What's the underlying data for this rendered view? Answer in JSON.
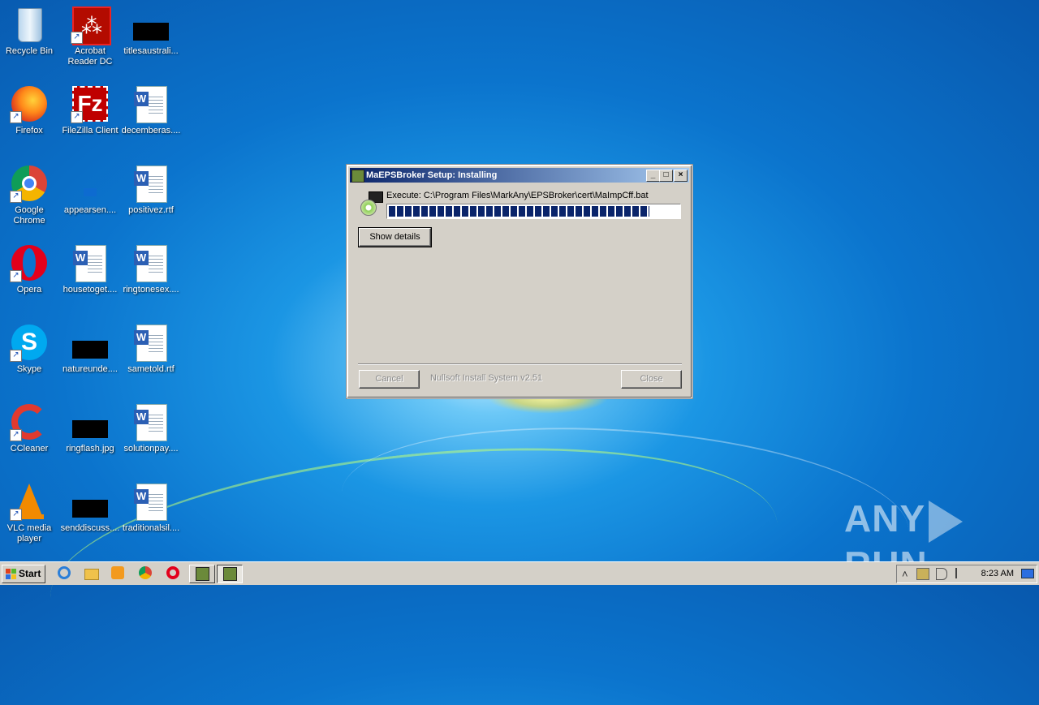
{
  "desktop": {
    "icons": [
      {
        "label": "Recycle Bin",
        "icon": "recycle-bin-icon"
      },
      {
        "label": "Acrobat Reader DC",
        "icon": "acrobat-icon"
      },
      {
        "label": "titlesaustrali...",
        "icon": "image-file-icon"
      },
      {
        "label": "Firefox",
        "icon": "firefox-icon"
      },
      {
        "label": "FileZilla Client",
        "icon": "filezilla-icon"
      },
      {
        "label": "decemberas....",
        "icon": "word-doc-icon"
      },
      {
        "label": "Google Chrome",
        "icon": "chrome-icon"
      },
      {
        "label": "appearsen....",
        "icon": "file-icon"
      },
      {
        "label": "positivez.rtf",
        "icon": "word-doc-icon"
      },
      {
        "label": "Opera",
        "icon": "opera-icon"
      },
      {
        "label": "housetoget....",
        "icon": "word-doc-icon"
      },
      {
        "label": "ringtonesex....",
        "icon": "word-doc-icon"
      },
      {
        "label": "Skype",
        "icon": "skype-icon"
      },
      {
        "label": "natureunde....",
        "icon": "image-file-icon"
      },
      {
        "label": "sametold.rtf",
        "icon": "word-doc-icon"
      },
      {
        "label": "CCleaner",
        "icon": "ccleaner-icon"
      },
      {
        "label": "ringflash.jpg",
        "icon": "image-file-icon"
      },
      {
        "label": "solutionpay....",
        "icon": "word-doc-icon"
      },
      {
        "label": "VLC media player",
        "icon": "vlc-icon"
      },
      {
        "label": "senddiscuss....",
        "icon": "image-file-icon"
      },
      {
        "label": "traditionalsil....",
        "icon": "word-doc-icon"
      }
    ]
  },
  "dialog": {
    "title": "MaEPSBroker Setup: Installing",
    "execute_text": "Execute: C:\\Program Files\\MarkAny\\EPSBroker\\cert\\MaImpCff.bat",
    "progress": 0.9,
    "show_details_label": "Show details",
    "cancel_label": "Cancel",
    "close_label": "Close",
    "branding": "Nullsoft Install System v2.51",
    "minimize_glyph": "_",
    "maximize_glyph": "□",
    "close_glyph": "×"
  },
  "taskbar": {
    "start_label": "Start",
    "clock": "8:23 AM",
    "tray_up_arrow": "˄",
    "quick_launch": [
      "internet-explorer-icon",
      "explorer-icon",
      "media-player-icon",
      "chrome-icon",
      "opera-icon"
    ]
  },
  "watermark": {
    "left": "ANY",
    "right": "RUN"
  },
  "colors": {
    "title_start": "#0a246a",
    "title_end": "#a6caf0",
    "progress": "#0a246a",
    "face": "#d4d0c8"
  }
}
